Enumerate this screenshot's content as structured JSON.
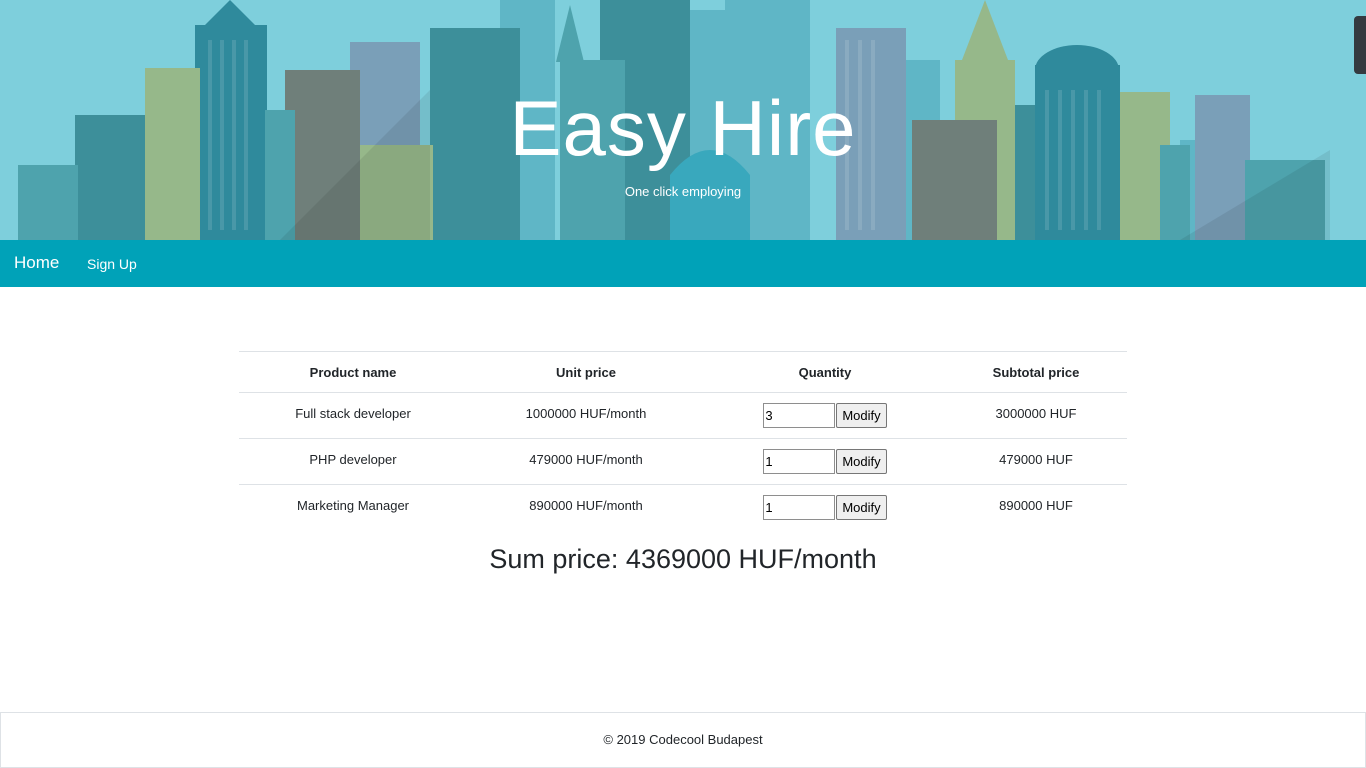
{
  "hero": {
    "title": "Easy Hire",
    "subtitle": "One click employing",
    "background_color": "#7ecfdc"
  },
  "nav": {
    "home_label": "Home",
    "signup_label": "Sign Up",
    "color": "#00a2b8"
  },
  "table": {
    "headers": {
      "product": "Product name",
      "unit_price": "Unit price",
      "quantity": "Quantity",
      "subtotal": "Subtotal price"
    },
    "rows": [
      {
        "name": "Full stack developer",
        "unit_price": "1000000 HUF/month",
        "quantity": "3",
        "button": "Modify",
        "subtotal": "3000000 HUF"
      },
      {
        "name": "PHP developer",
        "unit_price": "479000 HUF/month",
        "quantity": "1",
        "button": "Modify",
        "subtotal": "479000 HUF"
      },
      {
        "name": "Marketing Manager",
        "unit_price": "890000 HUF/month",
        "quantity": "1",
        "button": "Modify",
        "subtotal": "890000 HUF"
      }
    ]
  },
  "sum": {
    "text": "Sum price: 4369000 HUF/month"
  },
  "footer": {
    "text": "© 2019 Codecool Budapest"
  }
}
